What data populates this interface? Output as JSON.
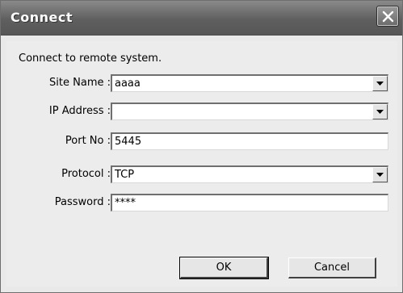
{
  "window": {
    "title": "Connect",
    "close_icon": "close-x-icon"
  },
  "caption": "Connect to remote system.",
  "fields": {
    "site_name": {
      "label": "Site Name :",
      "value": "aaaa"
    },
    "ip_address": {
      "label": "IP Address :",
      "value": ""
    },
    "port_no": {
      "label": "Port No :",
      "value": "5445"
    },
    "protocol": {
      "label": "Protocol :",
      "value": "TCP"
    },
    "password": {
      "label": "Password :",
      "value": "****"
    }
  },
  "buttons": {
    "ok": "OK",
    "cancel": "Cancel"
  },
  "icons": {
    "dropdown": "chevron-down-icon"
  }
}
